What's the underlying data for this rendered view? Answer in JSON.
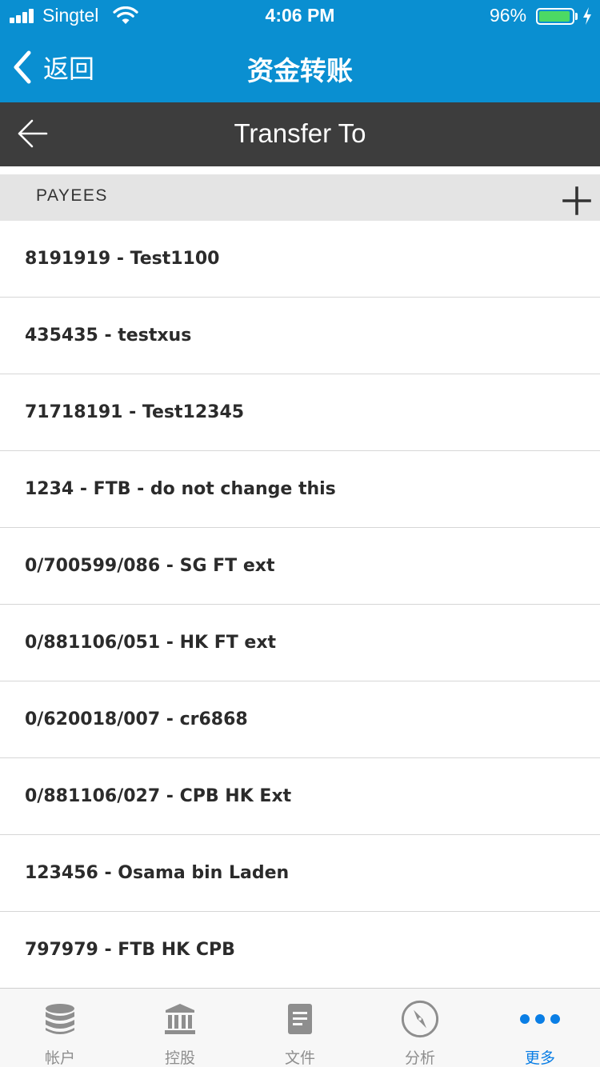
{
  "status_bar": {
    "carrier": "Singtel",
    "time": "4:06 PM",
    "battery_percent": "96%",
    "battery_level": 0.96,
    "battery_color": "#4cd964"
  },
  "nav": {
    "back_label": "返回",
    "title": "资金转账",
    "background": "#0a8fd1"
  },
  "sub_header": {
    "title": "Transfer To",
    "back_icon": "arrow-left-icon"
  },
  "payees": {
    "header": "PAYEES",
    "add_icon": "plus-icon",
    "items": [
      {
        "label": "8191919 - Test1100"
      },
      {
        "label": "435435 - testxus"
      },
      {
        "label": "71718191 - Test12345"
      },
      {
        "label": "1234 - FTB - do not change this"
      },
      {
        "label": "0/700599/086 - SG FT ext"
      },
      {
        "label": "0/881106/051 - HK FT ext"
      },
      {
        "label": "0/620018/007 - cr6868"
      },
      {
        "label": "0/881106/027 - CPB HK Ext"
      },
      {
        "label": "123456 - Osama bin Laden"
      },
      {
        "label": "797979 - FTB HK CPB"
      }
    ]
  },
  "tab_bar": {
    "active_color": "#0a7ee5",
    "tabs": [
      {
        "label": "帐户",
        "icon": "database-icon"
      },
      {
        "label": "控股",
        "icon": "bank-icon"
      },
      {
        "label": "文件",
        "icon": "document-icon"
      },
      {
        "label": "分析",
        "icon": "compass-icon"
      },
      {
        "label": "更多",
        "icon": "more-dots-icon",
        "active": true
      }
    ]
  }
}
